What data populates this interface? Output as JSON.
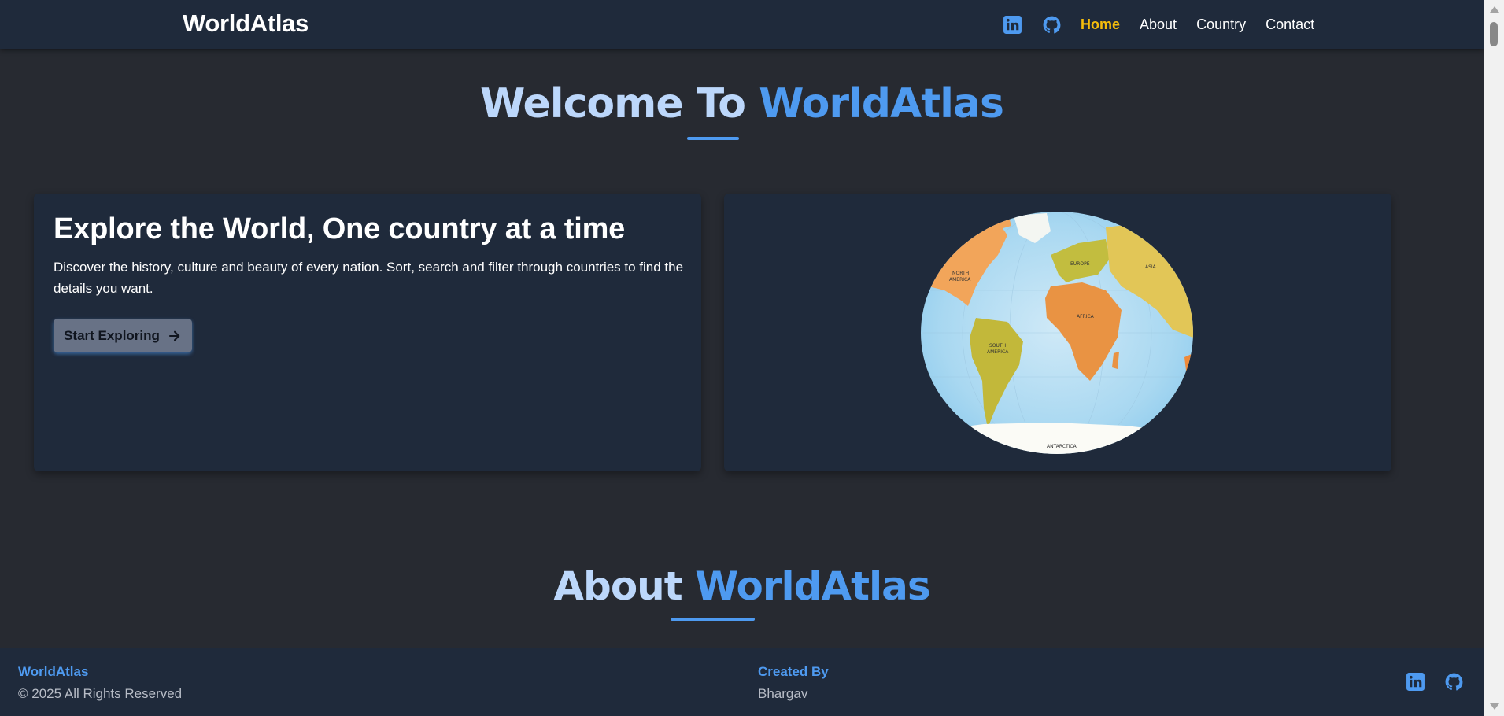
{
  "header": {
    "brand": "WorldAtlas",
    "nav": [
      {
        "label": "Home",
        "active": true
      },
      {
        "label": "About",
        "active": false
      },
      {
        "label": "Country",
        "active": false
      },
      {
        "label": "Contact",
        "active": false
      }
    ],
    "social_icons": [
      "linkedin-icon",
      "github-icon"
    ]
  },
  "welcome": {
    "prefix": "Welcome To",
    "accent": "WorldAtlas"
  },
  "hero": {
    "heading": "Explore the World, One country at a time",
    "description": "Discover the history, culture and beauty of every nation. Sort, search and filter through countries to find the details you want.",
    "button_label": "Start Exploring",
    "button_icon": "arrow-right-icon",
    "image": "world-map-globe",
    "map_labels": [
      "NORTH AMERICA",
      "EUROPE",
      "ASIA",
      "AFRICA",
      "SOUTH AMERICA",
      "ANTARCTICA"
    ]
  },
  "about": {
    "prefix": "About",
    "accent": "WorldAtlas"
  },
  "footer": {
    "brand": "WorldAtlas",
    "copyright": "© 2025 All Rights Reserved",
    "created_by_label": "Created By",
    "author": "Bhargav",
    "social_icons": [
      "linkedin-icon",
      "github-icon"
    ]
  },
  "colors": {
    "background": "#272a31",
    "panel": "#1f2a3b",
    "accent": "#4e9af0",
    "title_light": "#bcd7fb",
    "nav_active": "#f5bd0c",
    "button": "#687286"
  }
}
